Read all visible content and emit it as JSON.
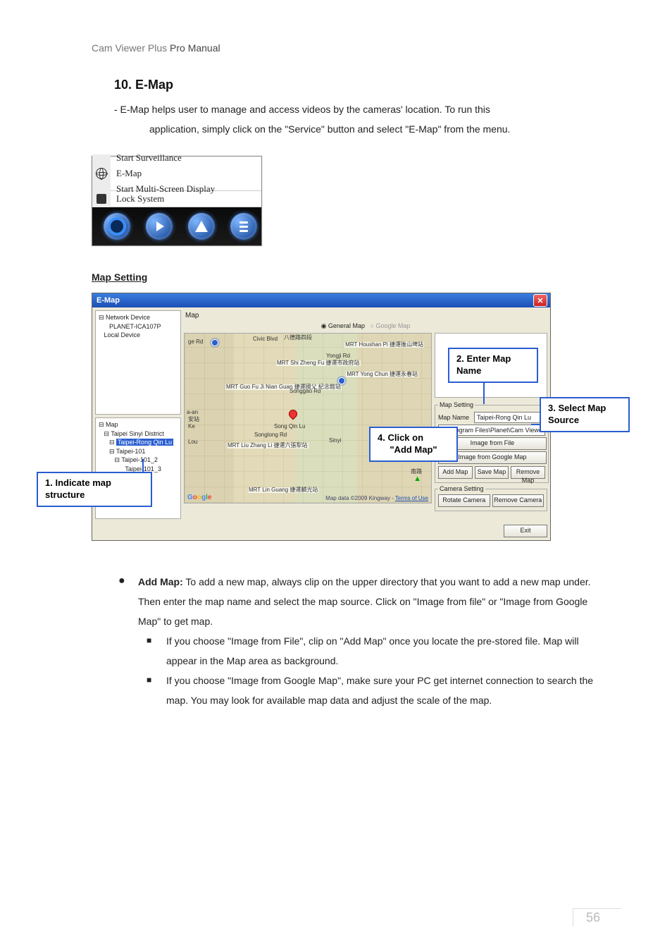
{
  "header": {
    "prefix": "Cam Viewer Plus ",
    "suffix": "Pro Manual"
  },
  "section": {
    "title": "10. E-Map"
  },
  "intro": {
    "line1": "-   E-Map helps user to manage and access videos by the cameras' location. To run this",
    "line2": "application, simply click on the \"Service\" button and select \"E-Map\" from the menu."
  },
  "context_menu": {
    "item1": "Start Surveillance",
    "item2": "E-Map",
    "item3": "Start Multi-Screen Display",
    "item4": "Lock System"
  },
  "subheading": "Map Setting",
  "emap": {
    "title": "E-Map",
    "tree_top": {
      "l1": "⊟ Network Device",
      "l2": "      PLANET-ICA107P",
      "l3": "   Local Device"
    },
    "tree_bottom": {
      "root": "⊟ Map",
      "l1": "   ⊟ Taipei Sinyi District",
      "sel": "Taipei-Rong Qin Lu",
      "l2": "      ⊟ Taipei-101",
      "l3": "         ⊟ Taipei-101_2",
      "l4": "               Taipei-101_3"
    },
    "map_label": "Map",
    "radio1": "General Map",
    "radio2": "Google Map",
    "mrt1": "MRT Shi\nZheng Fu\n捷運市政府站",
    "mrt2": "MRT\nHoushan Pi\n捷運後山埤站",
    "mrt3": "MRT Yong\nChun\n捷運永春站",
    "mrt4": "MRT Guo Fu\nJi Nian Guan\n捷運國父\n紀念館站",
    "mrt5": "MRT Liu\nZhang Li\n捷運六張犁站",
    "mrt6": "MRT Lin\nGuang\n捷運麟光站",
    "road1": "Song Qin Lu",
    "road2": "Songlong Rd",
    "road3": "Civic Blvd",
    "road4": "Yongji Rd",
    "road5": "Ke",
    "road6": "Lou",
    "road7": "Sinyi",
    "road8": "八德路四段",
    "road9": "ge Rd",
    "road10": "Songgao Rd",
    "road11": "安站",
    "road12": "a-an",
    "cam_label": "南路",
    "google": "Google",
    "attrib_text": "Map data ©2009 Kingway - ",
    "attrib_link": "Terms of Use",
    "mapsetting_legend": "Map Setting",
    "mapname_label": "Map Name",
    "mapname_value": "Taipei-Rong Qin Lu",
    "path_value": "C:\\Program Files\\Planet\\Cam Viewe",
    "btn_image_file": "Image from File",
    "btn_image_google": "Image from Google Map",
    "btn_add": "Add Map",
    "btn_save": "Save Map",
    "btn_remove": "Remove Map",
    "camset_legend": "Camera Setting",
    "btn_rotate": "Rotate Camera",
    "btn_remove_cam": "Remove Camera",
    "btn_exit": "Exit"
  },
  "callouts": {
    "c1": "1.    Indicate map structure",
    "c2": "2. Enter Map Name",
    "c3": "3. Select Map Source",
    "c4a": "4.    Click on",
    "c4b": "\"Add Map\""
  },
  "body": {
    "addmap_label": "Add Map:",
    "addmap_text": " To add a new map, always clip on the upper directory that you want to add a new map under. Then enter the map name and select the map source.    Click on \"Image from file\" or \"Image from Google Map\" to get map.",
    "sub1": "If you choose \"Image from File\", clip on \"Add Map\" once you locate the pre-stored file.    Map will appear in the Map area as background.",
    "sub2": "If you choose \"Image from Google Map\", make sure your PC get internet connection to search the map.    You may look for available map data and adjust the scale of the map."
  },
  "page_number": "56"
}
